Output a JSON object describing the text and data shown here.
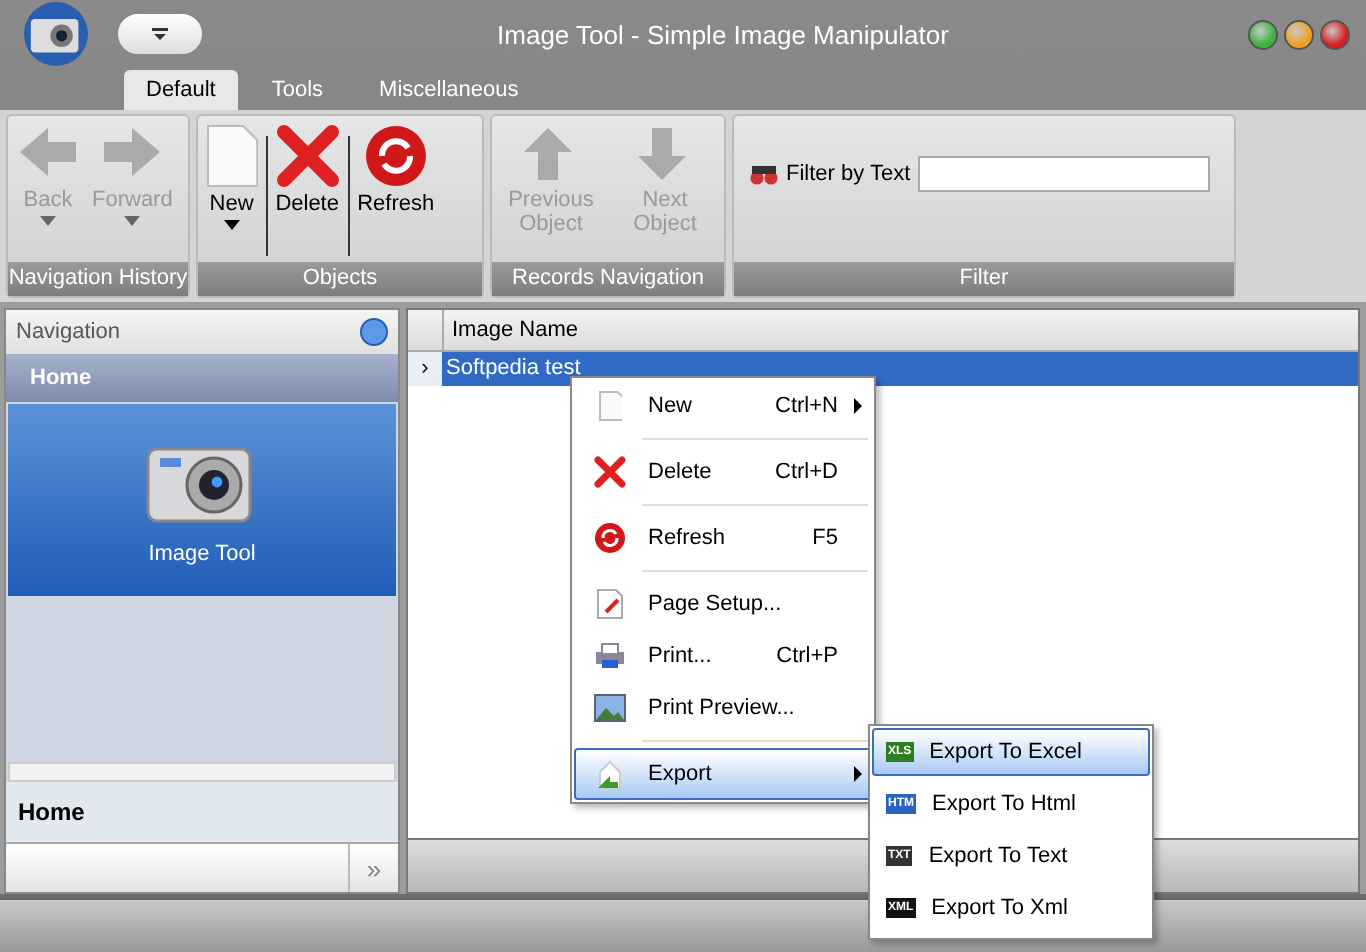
{
  "window": {
    "title": "Image Tool - Simple Image Manipulator"
  },
  "tabs": [
    {
      "label": "Default",
      "selected": true
    },
    {
      "label": "Tools",
      "selected": false
    },
    {
      "label": "Miscellaneous",
      "selected": false
    }
  ],
  "ribbon": [
    {
      "caption": "Navigation History",
      "buttons": [
        {
          "label": "Back",
          "disabled": true,
          "dropdown": true
        },
        {
          "label": "Forward",
          "disabled": true,
          "dropdown": true
        }
      ]
    },
    {
      "caption": "Objects",
      "buttons": [
        {
          "label": "New",
          "disabled": false,
          "dropdown": true
        },
        {
          "label": "Delete",
          "disabled": false,
          "dropdown": false
        },
        {
          "label": "Refresh",
          "disabled": false,
          "dropdown": false
        }
      ]
    },
    {
      "caption": "Records Navigation",
      "buttons": [
        {
          "label": "Previous Object",
          "disabled": true,
          "dropdown": false
        },
        {
          "label": "Next Object",
          "disabled": true,
          "dropdown": false
        }
      ]
    }
  ],
  "filter": {
    "caption": "Filter",
    "label": "Filter by Text"
  },
  "navigation": {
    "title": "Navigation",
    "group": "Home",
    "item": "Image Tool",
    "footer_group": "Home",
    "more": "»"
  },
  "grid": {
    "columns": [
      "Image Name"
    ],
    "rows": [
      {
        "marker": "›",
        "name": "Softpedia test",
        "selected": true
      }
    ]
  },
  "context_menu": {
    "groups": [
      [
        {
          "label": "New",
          "shortcut": "Ctrl+N",
          "submenu": true,
          "selected": false
        }
      ],
      [
        {
          "label": "Delete",
          "shortcut": "Ctrl+D",
          "submenu": false,
          "selected": false
        }
      ],
      [
        {
          "label": "Refresh",
          "shortcut": "F5",
          "submenu": false,
          "selected": false
        }
      ],
      [
        {
          "label": "Page Setup...",
          "submenu": false,
          "selected": false
        },
        {
          "label": "Print...",
          "shortcut": "Ctrl+P",
          "submenu": false,
          "selected": false
        },
        {
          "label": "Print Preview...",
          "submenu": false,
          "selected": false
        }
      ],
      [
        {
          "label": "Export",
          "submenu": true,
          "selected": true
        }
      ]
    ]
  },
  "submenu": [
    {
      "label": "Export To Excel",
      "badge": "XLS",
      "color": "#2e7d1e",
      "selected": true
    },
    {
      "label": "Export To Html",
      "badge": "HTM",
      "color": "#2a62c0",
      "selected": false
    },
    {
      "label": "Export To Text",
      "badge": "TXT",
      "color": "#333333",
      "selected": false
    },
    {
      "label": "Export To Xml",
      "badge": "XML",
      "color": "#111111",
      "selected": false
    }
  ]
}
